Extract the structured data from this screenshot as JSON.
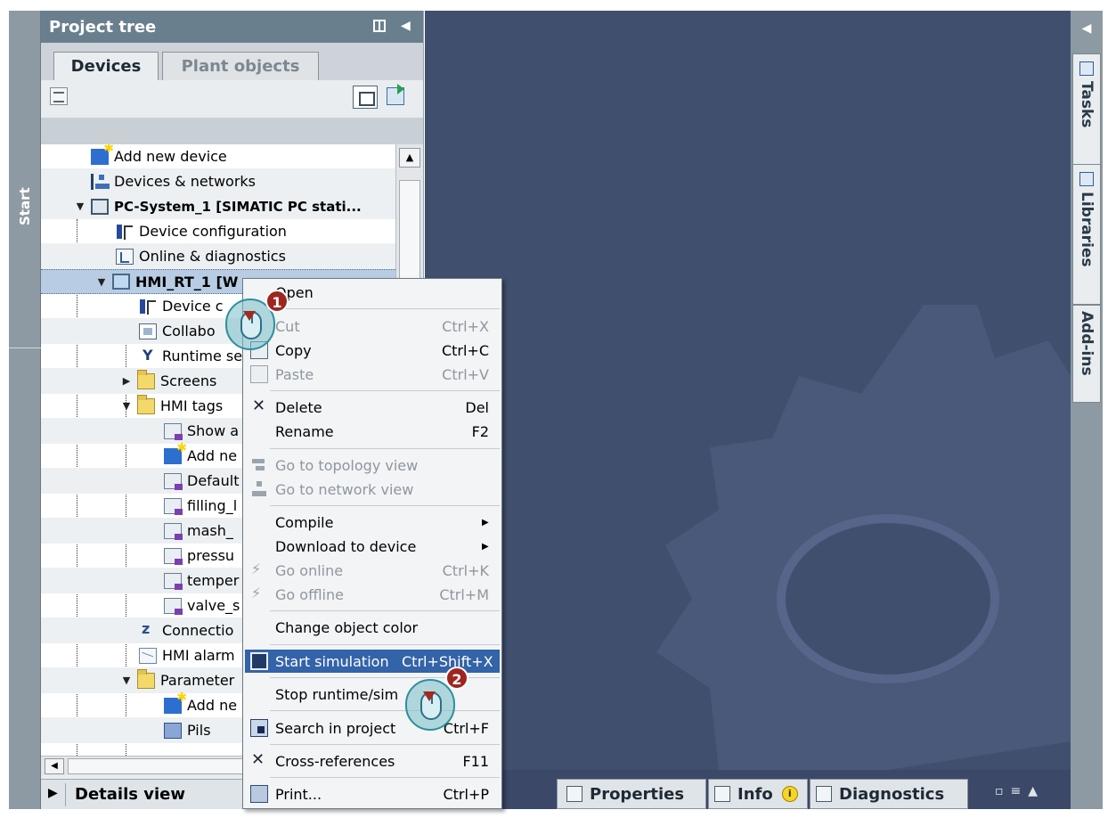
{
  "start_strip": {
    "label": "Start"
  },
  "project_tree": {
    "title": "Project tree",
    "tabs": [
      {
        "label": "Devices",
        "active": true
      },
      {
        "label": "Plant objects",
        "active": false
      }
    ],
    "items": [
      {
        "label": "Add new device",
        "icon": "add-device-icon"
      },
      {
        "label": "Devices & networks",
        "icon": "network-icon"
      },
      {
        "label": "PC-System_1 [SIMATIC PC stati...",
        "icon": "pc-system-icon"
      },
      {
        "label": "Device configuration",
        "icon": "device-config-icon"
      },
      {
        "label": "Online & diagnostics",
        "icon": "diagnostics-icon"
      },
      {
        "label": "HMI_RT_1 [W",
        "icon": "hmi-folder-icon"
      },
      {
        "label": "Device c",
        "icon": "device-config-icon"
      },
      {
        "label": "Collabo",
        "icon": "collaboration-icon"
      },
      {
        "label": "Runtime se",
        "icon": "runtime-settings-icon"
      },
      {
        "label": "Screens",
        "icon": "folder-icon"
      },
      {
        "label": "HMI tags",
        "icon": "folder-icon"
      },
      {
        "label": "Show a",
        "icon": "show-all-tags-icon"
      },
      {
        "label": "Add ne",
        "icon": "add-tag-table-icon"
      },
      {
        "label": "Default",
        "icon": "default-tag-table-icon"
      },
      {
        "label": "filling_l",
        "icon": "tag-table-icon"
      },
      {
        "label": "mash_",
        "icon": "tag-table-icon"
      },
      {
        "label": "pressu",
        "icon": "tag-table-icon"
      },
      {
        "label": "temper",
        "icon": "tag-table-icon"
      },
      {
        "label": "valve_s",
        "icon": "tag-table-icon"
      },
      {
        "label": "Connectio",
        "icon": "connections-icon"
      },
      {
        "label": "HMI alarm",
        "icon": "hmi-alarms-icon"
      },
      {
        "label": "Parameter",
        "icon": "folder-icon"
      },
      {
        "label": "Add ne",
        "icon": "add-icon"
      },
      {
        "label": "Pils",
        "icon": "pils-icon"
      }
    ],
    "details_view": "Details view"
  },
  "context_menu": {
    "items": [
      {
        "label": "Open",
        "shortcut": "",
        "enabled": true
      },
      {
        "label": "Cut",
        "shortcut": "Ctrl+X",
        "enabled": false
      },
      {
        "label": "Copy",
        "shortcut": "Ctrl+C",
        "enabled": true
      },
      {
        "label": "Paste",
        "shortcut": "Ctrl+V",
        "enabled": false
      },
      {
        "label": "Delete",
        "shortcut": "Del",
        "enabled": true
      },
      {
        "label": "Rename",
        "shortcut": "F2",
        "enabled": true
      },
      {
        "label": "Go to topology view",
        "shortcut": "",
        "enabled": false
      },
      {
        "label": "Go to network view",
        "shortcut": "",
        "enabled": false
      },
      {
        "label": "Compile",
        "shortcut": "",
        "enabled": true,
        "submenu": true
      },
      {
        "label": "Download to device",
        "shortcut": "",
        "enabled": true,
        "submenu": true
      },
      {
        "label": "Go online",
        "shortcut": "Ctrl+K",
        "enabled": false
      },
      {
        "label": "Go offline",
        "shortcut": "Ctrl+M",
        "enabled": false
      },
      {
        "label": "Change object color",
        "shortcut": "",
        "enabled": true
      },
      {
        "label": "Start simulation",
        "shortcut": "Ctrl+Shift+X",
        "enabled": true,
        "highlighted": true
      },
      {
        "label": "Stop runtime/sim",
        "shortcut": "",
        "enabled": true
      },
      {
        "label": "Search in project",
        "shortcut": "Ctrl+F",
        "enabled": true
      },
      {
        "label": "Cross-references",
        "shortcut": "F11",
        "enabled": true
      },
      {
        "label": "Print...",
        "shortcut": "Ctrl+P",
        "enabled": true
      }
    ],
    "submenu_glyph": "▶"
  },
  "callouts": [
    {
      "number": "1"
    },
    {
      "number": "2"
    }
  ],
  "bottom_bar": {
    "properties": "Properties",
    "info": "Info",
    "info_badge": "i",
    "diagnostics": "Diagnostics"
  },
  "right_strip": {
    "tabs": [
      {
        "label": "Tasks"
      },
      {
        "label": "Libraries"
      },
      {
        "label": "Add-ins"
      }
    ]
  },
  "colors": {
    "workspace_bg": "#414f6f",
    "header_bg": "#6a7f8e",
    "menu_highlight": "#3363a8",
    "callout_badge": "#9e2620"
  }
}
